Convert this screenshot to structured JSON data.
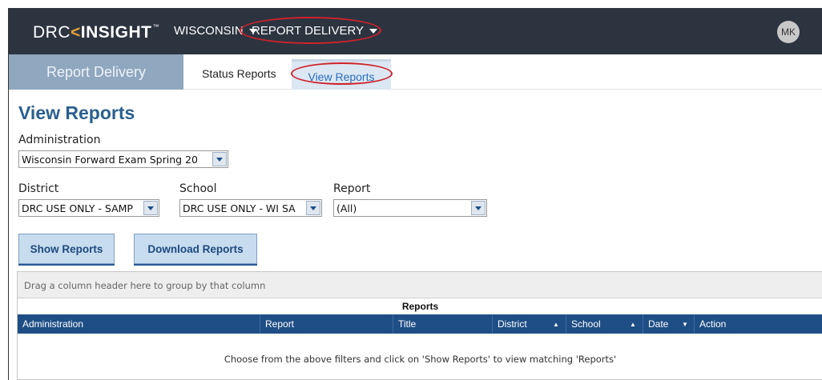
{
  "header": {
    "logo": {
      "drc": "DRC",
      "chevron": "<",
      "insight": "INSIGHT",
      "tm": "™"
    },
    "state_menu": "WISCONSIN",
    "report_menu": "REPORT DELIVERY",
    "avatar_initials": "MK"
  },
  "subnav": {
    "section_title": "Report Delivery",
    "tabs": [
      {
        "label": "Status Reports"
      },
      {
        "label": "View Reports"
      }
    ]
  },
  "main": {
    "title": "View Reports",
    "administration": {
      "label": "Administration",
      "value": "Wisconsin Forward Exam Spring 20"
    },
    "district": {
      "label": "District",
      "value": "DRC USE ONLY - SAMP"
    },
    "school": {
      "label": "School",
      "value": "DRC USE ONLY - WI SA"
    },
    "report": {
      "label": "Report",
      "value": "(All)"
    },
    "buttons": {
      "show": "Show Reports",
      "download": "Download Reports"
    }
  },
  "grid": {
    "group_hint": "Drag a column header here to group by that column",
    "caption": "Reports",
    "columns": [
      {
        "label": "Administration"
      },
      {
        "label": "Report"
      },
      {
        "label": "Title"
      },
      {
        "label": "District",
        "sort": "▲"
      },
      {
        "label": "School",
        "sort": "▲"
      },
      {
        "label": "Date",
        "sort": "▼"
      },
      {
        "label": "Action"
      }
    ],
    "empty_message": "Choose from the above filters and click on 'Show Reports' to view matching 'Reports'"
  },
  "colors": {
    "topbar": "#2c3440",
    "accent": "#e8a13a",
    "title_blue": "#2a5f8f",
    "grid_header": "#1f4e86",
    "highlight": "#d0222a"
  }
}
